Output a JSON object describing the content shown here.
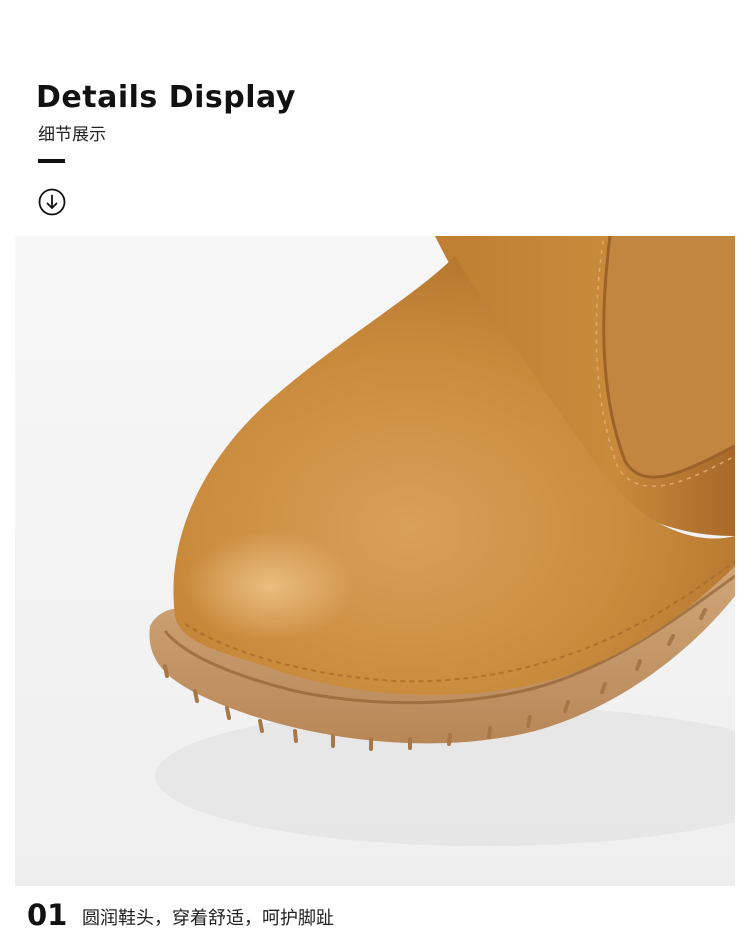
{
  "header": {
    "title": "Details Display",
    "subtitle": "细节展示",
    "scroll_icon": "arrow-down-circle-icon"
  },
  "photo": {
    "subject": "boot-toe-closeup",
    "leather_color": "#c98a3c",
    "sole_color": "#c99a6b",
    "background_color": "#f6f6f6"
  },
  "detail": {
    "number": "01",
    "caption": "圆润鞋头，穿着舒适，呵护脚趾"
  }
}
